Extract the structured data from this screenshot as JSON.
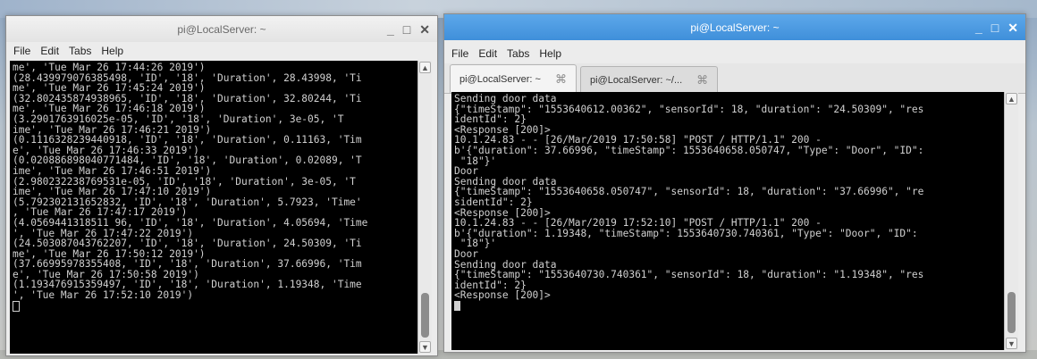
{
  "left_window": {
    "title": "pi@LocalServer: ~",
    "controls": {
      "minimize": "_",
      "maximize": "□",
      "close": "✕"
    },
    "menu": [
      "File",
      "Edit",
      "Tabs",
      "Help"
    ],
    "lines": [
      "me', 'Tue Mar 26 17:44:26 2019')",
      "(28.439979076385498, 'ID', '18', 'Duration', 28.43998, 'Ti",
      "me', 'Tue Mar 26 17:45:24 2019')",
      "(32.802435874938965, 'ID', '18', 'Duration', 32.80244, 'Ti",
      "me', 'Tue Mar 26 17:46:18 2019')",
      "(3.2901763916025e-05, 'ID', '18', 'Duration', 3e-05, 'T",
      "ime', 'Tue Mar 26 17:46:21 2019')",
      "(0.1116328239440918, 'ID', '18', 'Duration', 0.11163, 'Tim",
      "e', 'Tue Mar 26 17:46:33 2019')",
      "(0.020886898040771484, 'ID', '18', 'Duration', 0.02089, 'T",
      "ime', 'Tue Mar 26 17:46:51 2019')",
      "(2.980232238769531e-05, 'ID', '18', 'Duration', 3e-05, 'T",
      "ime', 'Tue Mar 26 17:47:10 2019')",
      "(5.792302131652832, 'ID', '18', 'Duration', 5.7923, 'Time'",
      ", 'Tue Mar 26 17:47:17 2019')",
      "(4.0569441318511 96, 'ID', '18', 'Duration', 4.05694, 'Time",
      "', 'Tue Mar 26 17:47:22 2019')",
      "(24.503087043762207, 'ID', '18', 'Duration', 24.50309, 'Ti",
      "me', 'Tue Mar 26 17:50:12 2019')",
      "(37.66995978355408, 'ID', '18', 'Duration', 37.66996, 'Tim",
      "e', 'Tue Mar 26 17:50:58 2019')",
      "(1.193476915359497, 'ID', '18', 'Duration', 1.19348, 'Time",
      "', 'Tue Mar 26 17:52:10 2019')"
    ]
  },
  "right_window": {
    "title": "pi@LocalServer: ~",
    "controls": {
      "minimize": "_",
      "maximize": "□",
      "close": "✕"
    },
    "menu": [
      "File",
      "Edit",
      "Tabs",
      "Help"
    ],
    "tabs": [
      {
        "label": "pi@LocalServer: ~",
        "close": "⌘"
      },
      {
        "label": "pi@LocalServer: ~/...",
        "close": "⌘"
      }
    ],
    "lines": [
      "Sending door data",
      "{\"timeStamp\": \"1553640612.00362\", \"sensorId\": 18, \"duration\": \"24.50309\", \"res",
      "identId\": 2}",
      "<Response [200]>",
      "10.1.24.83 - - [26/Mar/2019 17:50:58] \"POST / HTTP/1.1\" 200 -",
      "b'{\"duration\": 37.66996, \"timeStamp\": 1553640658.050747, \"Type\": \"Door\", \"ID\":",
      " \"18\"}'",
      "Door",
      "Sending door data",
      "{\"timeStamp\": \"1553640658.050747\", \"sensorId\": 18, \"duration\": \"37.66996\", \"re",
      "sidentId\": 2}",
      "<Response [200]>",
      "10.1.24.83 - - [26/Mar/2019 17:52:10] \"POST / HTTP/1.1\" 200 -",
      "b'{\"duration\": 1.19348, \"timeStamp\": 1553640730.740361, \"Type\": \"Door\", \"ID\":",
      " \"18\"}'",
      "Door",
      "Sending door data",
      "{\"timeStamp\": \"1553640730.740361\", \"sensorId\": 18, \"duration\": \"1.19348\", \"res",
      "identId\": 2}",
      "<Response [200]>"
    ]
  }
}
